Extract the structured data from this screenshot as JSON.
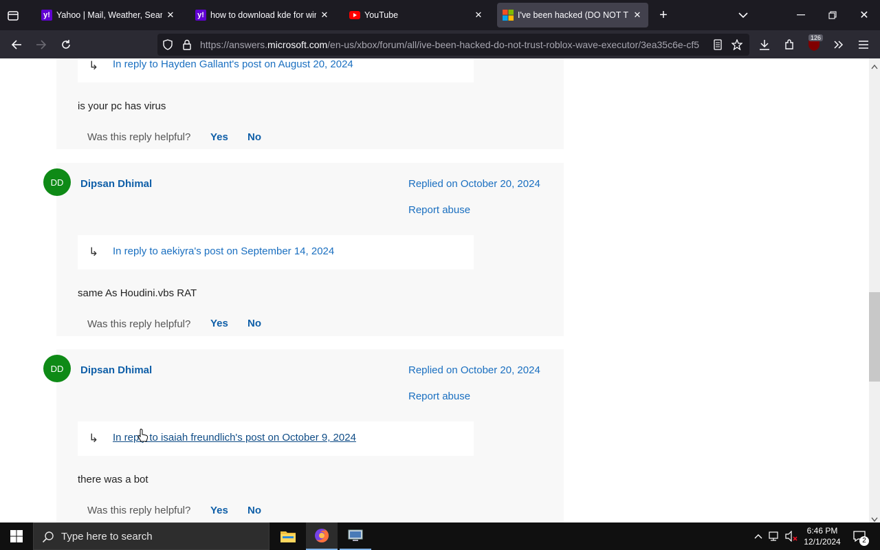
{
  "browser": {
    "tabs": [
      {
        "title": "Yahoo | Mail, Weather, Search, P",
        "favicon": "yahoo-icon",
        "active": false
      },
      {
        "title": "how to download kde for windo",
        "favicon": "yahoo-icon",
        "active": false
      },
      {
        "title": "YouTube",
        "favicon": "youtube-icon",
        "active": false
      },
      {
        "title": "I've been hacked (DO NOT TRUS",
        "favicon": "microsoft-icon",
        "active": true
      }
    ],
    "url_prefix": "https://answers.",
    "url_domain": "microsoft.com",
    "url_path": "/en-us/xbox/forum/all/ive-been-hacked-do-not-trust-roblox-wave-executor/3ea35c6e-cf5",
    "extension_badge": "126"
  },
  "posts": [
    {
      "reply_to": "In reply to Hayden Gallant's post on August 20, 2024",
      "body": "is your pc has virus",
      "helpful_label": "Was this reply helpful?",
      "yes": "Yes",
      "no": "No"
    },
    {
      "initials": "DD",
      "author": "Dipsan Dhimal",
      "replied": "Replied on October 20, 2024",
      "report": "Report abuse",
      "reply_to": "In reply to aekiyra's post on September 14, 2024",
      "body": "same As Houdini.vbs RAT",
      "helpful_label": "Was this reply helpful?",
      "yes": "Yes",
      "no": "No"
    },
    {
      "initials": "DD",
      "author": "Dipsan Dhimal",
      "replied": "Replied on October 20, 2024",
      "report": "Report abuse",
      "reply_to": "In reply to isaiah freundlich's post on October 9, 2024",
      "body": "there was a bot",
      "helpful_label": "Was this reply helpful?",
      "yes": "Yes",
      "no": "No"
    }
  ],
  "taskbar": {
    "search_placeholder": "Type here to search",
    "time": "6:46 PM",
    "date": "12/1/2024",
    "notification_count": "2"
  },
  "colors": {
    "link": "#1a6fc0",
    "avatar": "#0e8a16"
  }
}
